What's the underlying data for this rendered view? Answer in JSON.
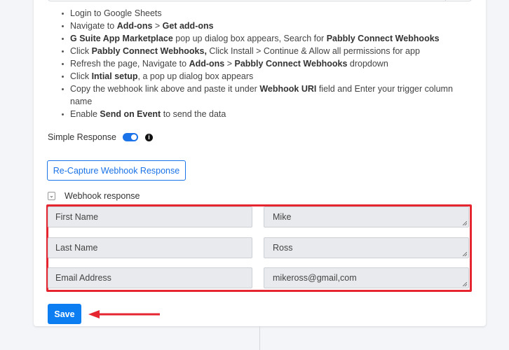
{
  "instructions": [
    [
      {
        "t": "Login to Google Sheets"
      }
    ],
    [
      {
        "t": "Navigate to "
      },
      {
        "t": "Add-ons",
        "b": true
      },
      {
        "t": " > "
      },
      {
        "t": "Get add-ons",
        "b": true
      }
    ],
    [
      {
        "t": "G Suite App Marketplace",
        "b": true
      },
      {
        "t": " pop up dialog box appears, Search for "
      },
      {
        "t": "Pabbly Connect Webhooks",
        "b": true
      }
    ],
    [
      {
        "t": "Click "
      },
      {
        "t": "Pabbly Connect Webhooks,",
        "b": true
      },
      {
        "t": " Click Install > Continue & Allow all permissions for app"
      }
    ],
    [
      {
        "t": "Refresh the page, Navigate to "
      },
      {
        "t": "Add-ons",
        "b": true
      },
      {
        "t": " > "
      },
      {
        "t": "Pabbly Connect Webhooks",
        "b": true
      },
      {
        "t": " dropdown"
      }
    ],
    [
      {
        "t": "Click "
      },
      {
        "t": "Intial setup",
        "b": true
      },
      {
        "t": ", a pop up dialog box appears"
      }
    ],
    [
      {
        "t": "Copy the webhook link above and paste it under "
      },
      {
        "t": "Webhook URI",
        "b": true
      },
      {
        "t": " field and Enter your trigger column name"
      }
    ],
    [
      {
        "t": "Enable "
      },
      {
        "t": "Send on Event",
        "b": true
      },
      {
        "t": " to send the data"
      }
    ]
  ],
  "simple_response": {
    "label": "Simple Response",
    "enabled": true,
    "info_icon": "info-circle-icon"
  },
  "recapture_label": "Re-Capture Webhook Response",
  "webhook_response": {
    "label": "Webhook response",
    "expanded": true,
    "fields": [
      {
        "key": "First Name",
        "value": "Mike"
      },
      {
        "key": "Last Name",
        "value": "Ross"
      },
      {
        "key": "Email Address",
        "value": "mikeross@gmail,com"
      }
    ]
  },
  "save_label": "Save",
  "colors": {
    "accent": "#1a73e8",
    "highlight": "#e52530",
    "save": "#0d7df2"
  }
}
